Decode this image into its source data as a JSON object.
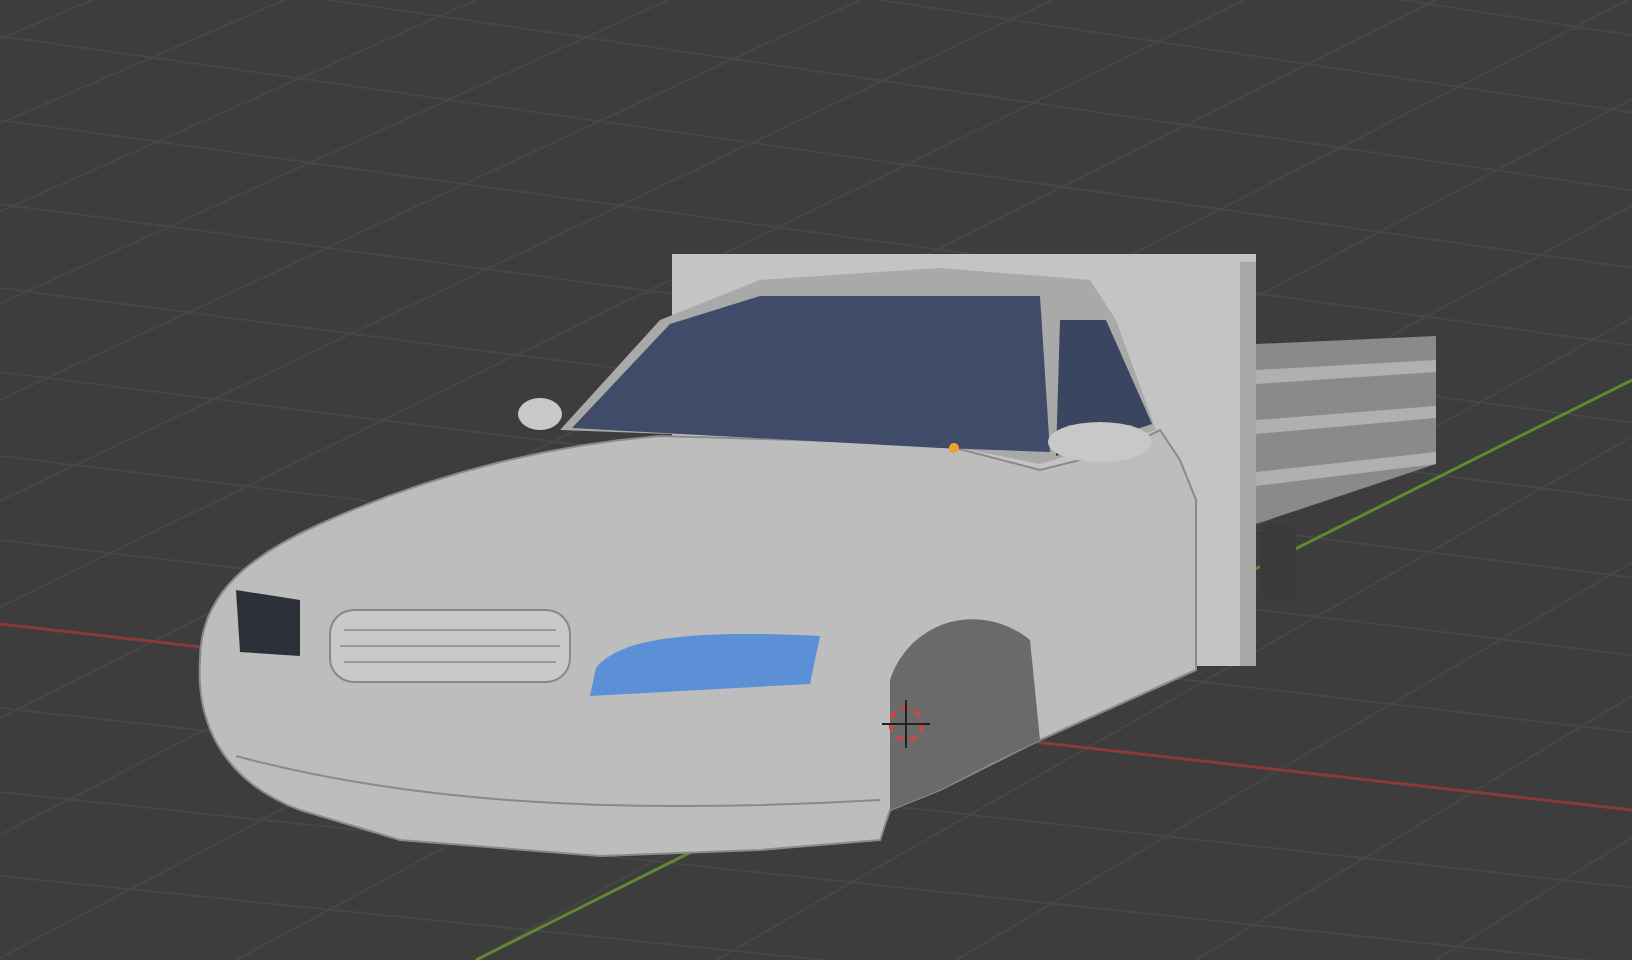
{
  "viewport": {
    "kind": "perspective"
  }
}
